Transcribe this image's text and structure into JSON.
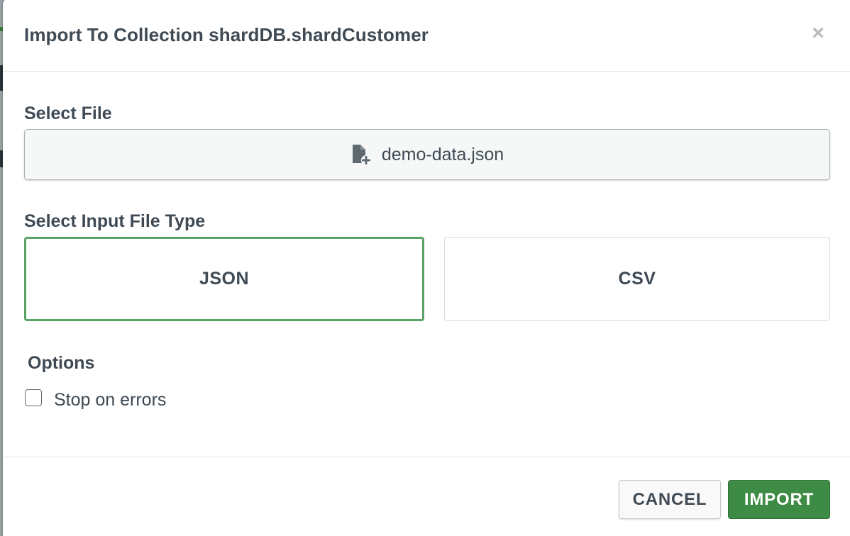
{
  "modal": {
    "title": "Import To Collection shardDB.shardCustomer",
    "close_glyph": "×"
  },
  "file_section": {
    "label": "Select File",
    "file_name": "demo-data.json",
    "icon": "file-plus-icon"
  },
  "file_type_section": {
    "label": "Select Input File Type",
    "options": [
      {
        "label": "JSON",
        "selected": true
      },
      {
        "label": "CSV",
        "selected": false
      }
    ]
  },
  "options_section": {
    "label": "Options",
    "stop_on_errors": {
      "label": "Stop on errors",
      "checked": false
    }
  },
  "footer": {
    "cancel_label": "CANCEL",
    "import_label": "IMPORT"
  },
  "colors": {
    "accent_green": "#3d8b45",
    "selected_border": "#5ba365",
    "text": "#3f4a54"
  }
}
